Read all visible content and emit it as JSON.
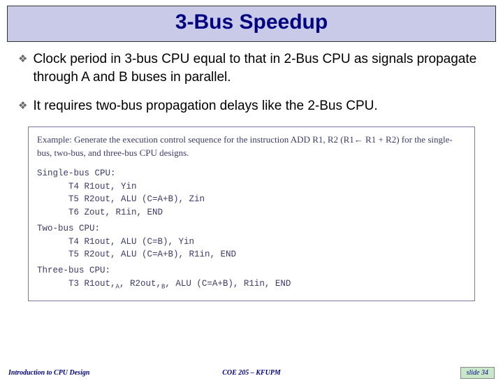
{
  "title": "3-Bus Speedup",
  "bullets": [
    "Clock period in 3-bus CPU equal to that in 2-Bus CPU as signals propagate through A and B buses in parallel.",
    " It requires two-bus propagation delays like the 2-Bus CPU."
  ],
  "example": {
    "prompt": "Example: Generate the execution control sequence for the instruction ADD R1, R2 (R1← R1 + R2) for the single-bus, two-bus, and three-bus CPU designs.",
    "single_label": "Single-bus CPU:",
    "single_code": "      T4 R1out, Yin\n      T5 R2out, ALU (C=A+B), Zin\n      T6 Zout, R1in, END",
    "two_label": "Two-bus CPU:",
    "two_code": "      T4 R1out, ALU (C=B), Yin\n      T5 R2out, ALU (C=A+B), R1in, END",
    "three_label": "Three-bus CPU:",
    "three_line": "      T3 R1out,A, R2out,B, ALU (C=A+B), R1in, END"
  },
  "footer": {
    "left": "Introduction to CPU Design",
    "center": "COE 205 – KFUPM",
    "right": "slide 34"
  }
}
